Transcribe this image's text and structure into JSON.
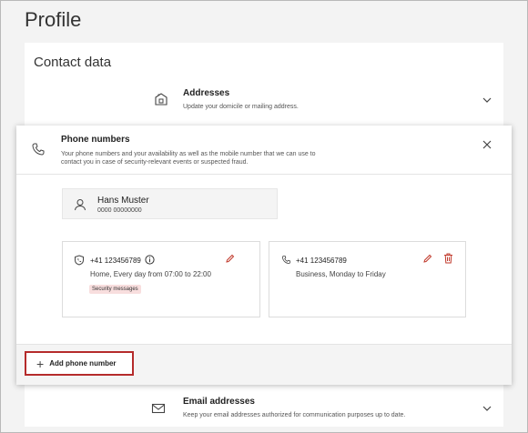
{
  "page": {
    "title": "Profile"
  },
  "contact": {
    "title": "Contact data",
    "addresses": {
      "title": "Addresses",
      "description": "Update your domicile or mailing address."
    },
    "phone": {
      "title": "Phone numbers",
      "description": "Your phone numbers and your availability as well as the mobile number that we can use to contact you in case of security-relevant events or suspected fraud.",
      "user": {
        "name": "Hans Muster",
        "number": "0000 00000000"
      },
      "numbers": [
        {
          "number": "+41 123456789",
          "detail": "Home, Every day from 07:00 to 22:00",
          "badge": "Security messages"
        },
        {
          "number": "+41 123456789",
          "detail": "Business, Monday to Friday"
        }
      ],
      "add_label": "Add phone number"
    },
    "email": {
      "title": "Email addresses",
      "description": "Keep your email addresses authorized for communication purposes up to date."
    }
  },
  "colors": {
    "accent_red": "#b52b2b",
    "badge_bg": "#f8dede",
    "icon_red": "#c0392b"
  }
}
